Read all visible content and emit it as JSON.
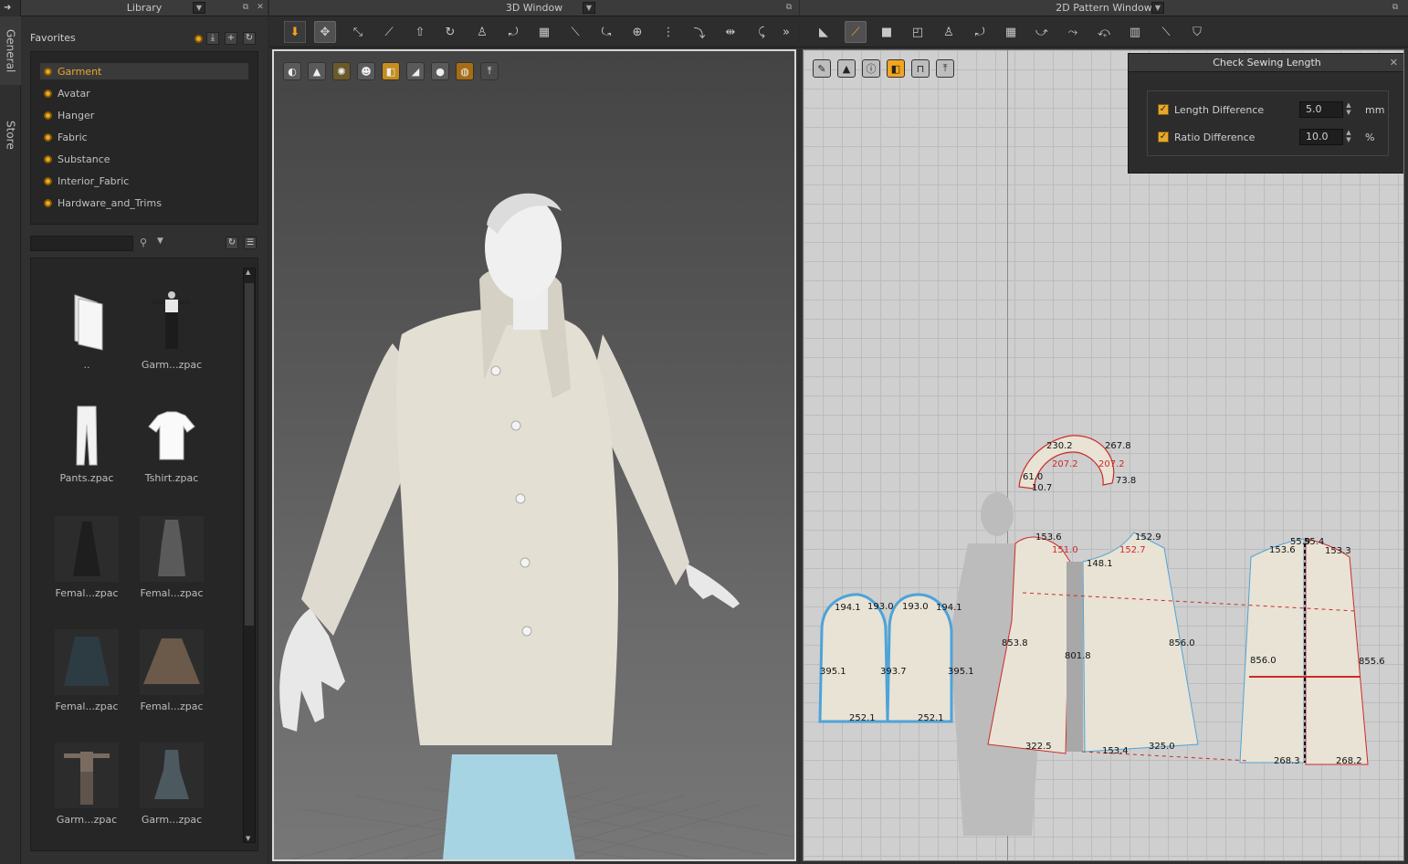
{
  "side_tabs": {
    "general": "General",
    "store": "Store"
  },
  "library": {
    "title": "Library",
    "favorites_title": "Favorites",
    "favorites": [
      "Garment",
      "Avatar",
      "Hanger",
      "Fabric",
      "Substance",
      "Interior_Fabric",
      "Hardware_and_Trims"
    ],
    "active_favorite": "Garment",
    "search_placeholder": "",
    "items": [
      {
        "label": "..",
        "icon": "folder-icon"
      },
      {
        "label": "Garm...zpac",
        "icon": "outfit-thumb"
      },
      {
        "label": "Pants.zpac",
        "icon": "pants-thumb"
      },
      {
        "label": "Tshirt.zpac",
        "icon": "tshirt-thumb"
      },
      {
        "label": "Femal...zpac",
        "icon": "dress-thumb"
      },
      {
        "label": "Femal...zpac",
        "icon": "dress-thumb"
      },
      {
        "label": "Femal...zpac",
        "icon": "skirt-thumb"
      },
      {
        "label": "Femal...zpac",
        "icon": "skirt-thumb"
      },
      {
        "label": "Garm...zpac",
        "icon": "outfit-thumb"
      },
      {
        "label": "Garm...zpac",
        "icon": "dress-thumb"
      }
    ]
  },
  "window3d": {
    "title": "3D Window"
  },
  "window2d": {
    "title": "2D Pattern Window"
  },
  "dialog": {
    "title": "Check Sewing Length",
    "length_label": "Length Difference",
    "length_value": "5.0",
    "length_unit": "mm",
    "ratio_label": "Ratio Difference",
    "ratio_value": "10.0",
    "ratio_unit": "%"
  },
  "measurements": {
    "collar": [
      "230.2",
      "267.8",
      "207.2",
      "207.2",
      "73.8",
      "61.0",
      "10.7"
    ],
    "sleeve": [
      "194.1",
      "193.0",
      "193.0",
      "194.1",
      "395.1",
      "395.1",
      "252.1",
      "252.1",
      "393.7"
    ],
    "front": [
      "153.6",
      "151.0",
      "148.1",
      "152.9",
      "152.7",
      "853.8",
      "801.8",
      "856.0",
      "322.5",
      "153.4",
      "325.0"
    ],
    "back": [
      "153.6",
      "55.9",
      "55.4",
      "153.3",
      "856.0",
      "855.6",
      "268.3",
      "268.2"
    ]
  },
  "colors": {
    "accent": "#e8a82c",
    "pattern_fill": "#e8e3d5",
    "seam_red": "#cc2a2a",
    "seam_blue": "#4ea3d8"
  }
}
